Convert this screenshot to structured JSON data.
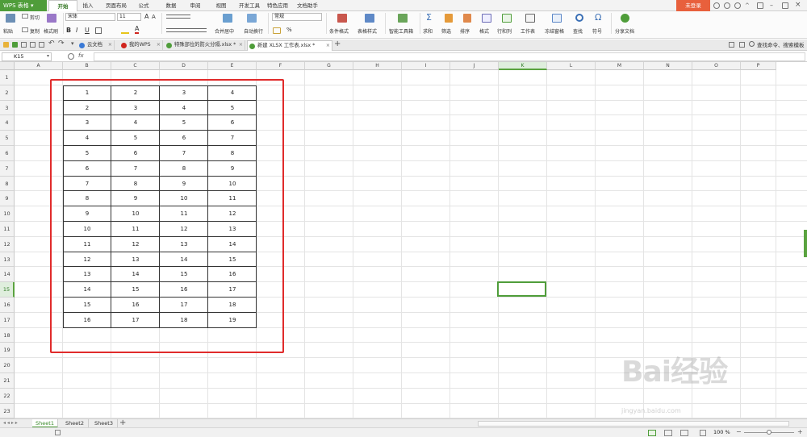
{
  "app": {
    "name": "WPS 表格",
    "login": "未登录"
  },
  "menu_tabs": [
    "开始",
    "插入",
    "页面布局",
    "公式",
    "数据",
    "审阅",
    "视图",
    "开发工具",
    "特色应用",
    "文档助手"
  ],
  "active_menu_tab": "开始",
  "ribbon": {
    "paste": "粘贴",
    "cut": "剪切",
    "copy": "复制",
    "format_painter": "格式刷",
    "font_name": "宋体",
    "font_size": "11",
    "bold": "B",
    "italic": "I",
    "underline": "U",
    "merge_center": "合并居中",
    "wrap_text": "自动换行",
    "number_format": "常规",
    "percent": "%",
    "conditional_format": "条件格式",
    "table_style": "表格样式",
    "smart_toolbox": "智能工具箱",
    "sum": "求和",
    "filter": "筛选",
    "sort": "排序",
    "format": "格式",
    "row_col": "行和列",
    "worksheet": "工作表",
    "freeze": "冻结窗格",
    "find": "查找",
    "symbol": "符号",
    "share": "分享文档"
  },
  "doc_tabs": [
    {
      "label": "云文档",
      "active": false
    },
    {
      "label": "我的WPS",
      "active": false
    },
    {
      "label": "特殊部位的防火分隔.xlsx *",
      "active": false
    },
    {
      "label": "新建 XLSX 工作表.xlsx *",
      "active": true
    }
  ],
  "search_hint": "查找命令、搜索模板",
  "formula_bar": {
    "name_box": "K15",
    "fx": "fx",
    "content": ""
  },
  "columns": [
    "A",
    "B",
    "C",
    "D",
    "E",
    "F",
    "G",
    "H",
    "I",
    "J",
    "K",
    "L",
    "M",
    "N",
    "O",
    "P"
  ],
  "selected_column": "K",
  "rows": [
    "1",
    "2",
    "3",
    "4",
    "5",
    "6",
    "7",
    "8",
    "9",
    "10",
    "11",
    "12",
    "13",
    "14",
    "15",
    "16",
    "17",
    "18",
    "19",
    "20",
    "21",
    "22",
    "23"
  ],
  "selected_row": "15",
  "table_values": [
    [
      "1",
      "2",
      "3",
      "4"
    ],
    [
      "2",
      "3",
      "4",
      "5"
    ],
    [
      "3",
      "4",
      "5",
      "6"
    ],
    [
      "4",
      "5",
      "6",
      "7"
    ],
    [
      "5",
      "6",
      "7",
      "8"
    ],
    [
      "6",
      "7",
      "8",
      "9"
    ],
    [
      "7",
      "8",
      "9",
      "10"
    ],
    [
      "8",
      "9",
      "10",
      "11"
    ],
    [
      "9",
      "10",
      "11",
      "12"
    ],
    [
      "10",
      "11",
      "12",
      "13"
    ],
    [
      "11",
      "12",
      "13",
      "14"
    ],
    [
      "12",
      "13",
      "14",
      "15"
    ],
    [
      "13",
      "14",
      "15",
      "16"
    ],
    [
      "14",
      "15",
      "16",
      "17"
    ],
    [
      "15",
      "16",
      "17",
      "18"
    ],
    [
      "16",
      "17",
      "18",
      "19"
    ]
  ],
  "sheets": [
    "Sheet1",
    "Sheet2",
    "Sheet3"
  ],
  "active_sheet": "Sheet1",
  "status": {
    "zoom": "100 %"
  },
  "watermark": {
    "text": "Bai经验",
    "sub": "jingyan.baidu.com"
  },
  "colors": {
    "accent": "#4f9d3a",
    "login": "#e8603c",
    "highlight_box": "#e02b2b"
  }
}
